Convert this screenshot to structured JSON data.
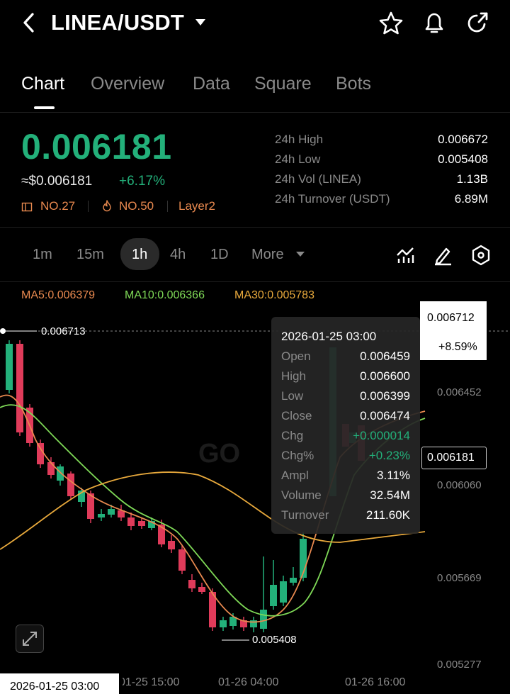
{
  "header": {
    "pair": "LINEA/USDT",
    "back_icon": "chevron-left-icon",
    "dropdown_icon": "caret-down-icon",
    "actions": [
      "star-icon",
      "bell-icon",
      "share-icon"
    ]
  },
  "tabs": [
    {
      "label": "Chart",
      "active": true
    },
    {
      "label": "Overview"
    },
    {
      "label": "Data"
    },
    {
      "label": "Square"
    },
    {
      "label": "Bots"
    }
  ],
  "ticker": {
    "last_price": "0.006181",
    "usd_price": "≈$0.006181",
    "change_pct": "+6.17%",
    "tags": [
      "NO.27",
      "NO.50",
      "Layer2"
    ]
  },
  "stats": [
    {
      "label": "24h  High",
      "value": "0.006672"
    },
    {
      "label": "24h  Low",
      "value": "0.005408"
    },
    {
      "label": "24h  Vol (LINEA)",
      "value": "1.13B"
    },
    {
      "label": "24h  Turnover (USDT)",
      "value": "6.89M"
    }
  ],
  "timeframes": [
    "1m",
    "15m",
    "1h",
    "4h",
    "1D"
  ],
  "timeframe_active": "1h",
  "more_label": "More",
  "ma_legend": {
    "ma5": "MA5:0.006379",
    "ma10": "MA10:0.006366",
    "ma30": "MA30:0.005783"
  },
  "colors": {
    "up": "#23b07a",
    "down": "#e03b5a",
    "ma5": "#e8894f",
    "ma10": "#7fd957",
    "ma30": "#e8a93c"
  },
  "tooltip": {
    "time": "2026-01-25 03:00",
    "rows": [
      {
        "k": "Open",
        "v": "0.006459"
      },
      {
        "k": "High",
        "v": "0.006600"
      },
      {
        "k": "Low",
        "v": "0.006399"
      },
      {
        "k": "Close",
        "v": "0.006474"
      },
      {
        "k": "Chg",
        "v": "+0.000014",
        "color": "up"
      },
      {
        "k": "Chg%",
        "v": "+0.23%",
        "color": "up"
      },
      {
        "k": "Ampl",
        "v": "3.11%"
      },
      {
        "k": "Volume",
        "v": "32.54M"
      },
      {
        "k": "Turnover",
        "v": "211.60K"
      }
    ]
  },
  "chart_data": {
    "type": "candlestick",
    "y_ticks": [
      "0.006452",
      "0.006060",
      "0.005669",
      "0.005277"
    ],
    "x_ticks": [
      "01-25 15:00",
      "01-26 04:00",
      "01-26 16:00"
    ],
    "crosshair_price": "0.006712",
    "crosshair_change": "+8.59%",
    "last_price_marker": "0.006181",
    "max_marker": "0.006713",
    "min_marker": "0.005408",
    "crosshair_time": "2026-01-25 03:00",
    "ylim": [
      0.00518,
      0.00678
    ]
  },
  "watermark": "GO"
}
